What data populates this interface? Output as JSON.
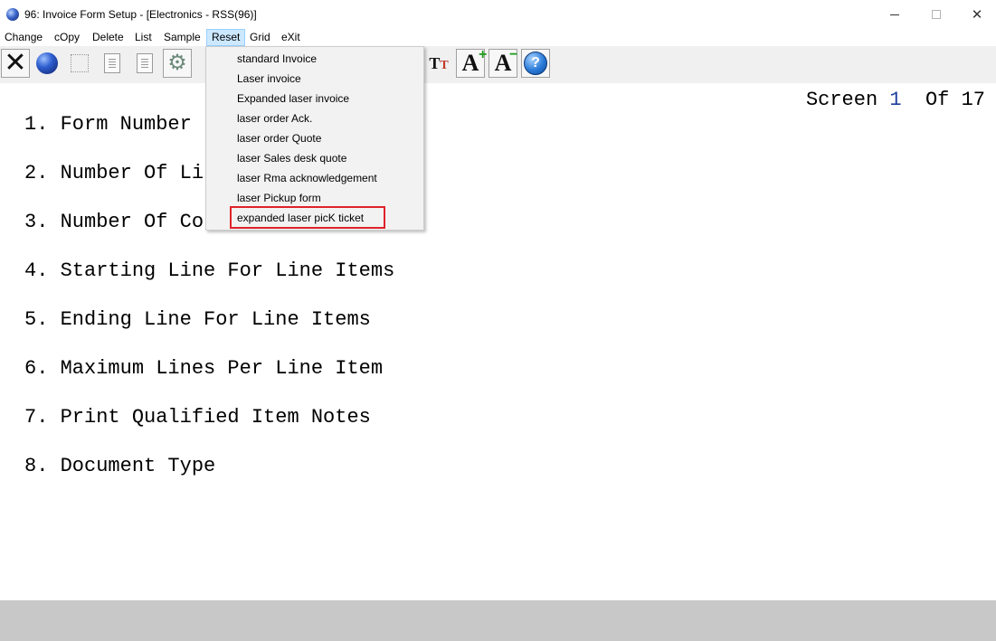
{
  "window": {
    "title": "96: Invoice Form Setup - [Electronics - RSS(96)]",
    "minimize_icon": "minimize-icon",
    "maximize_icon": "maximize-icon",
    "close_glyph": "✕"
  },
  "menubar": {
    "items": [
      "Change",
      "cOpy",
      "Delete",
      "List",
      "Sample",
      "Reset",
      "Grid",
      "eXit"
    ],
    "active": "Reset"
  },
  "toolbar": {
    "icons": [
      "close-x-icon",
      "globe-icon",
      "select-icon",
      "copy-doc-icon",
      "paste-icon",
      "gear-icon",
      "font-tt-icon",
      "font-increase-icon",
      "font-decrease-icon",
      "help-icon"
    ],
    "help_glyph": "?"
  },
  "reset_menu": {
    "items": [
      "standard Invoice",
      "Laser invoice",
      "Expanded laser invoice",
      "laser order Ack.",
      "laser order Quote",
      "laser Sales desk quote",
      "laser Rma acknowledgement",
      "laser Pickup form",
      "expanded laser picK ticket"
    ],
    "highlighted": "expanded laser picK ticket"
  },
  "screen": {
    "label": "Screen",
    "current": "1",
    "of_label": "Of",
    "total": "17"
  },
  "fields": [
    "1. Form Number",
    "2. Number Of Li",
    "3. Number Of Co",
    "4. Starting Line For Line Items",
    "5. Ending Line For Line Items",
    "6. Maximum Lines Per Line Item",
    "7. Print Qualified Item Notes",
    "8. Document Type"
  ],
  "colors": {
    "highlight_border": "#e0222a",
    "active_menu_bg": "#cce8ff",
    "screen_number": "#1f3f9f",
    "statusbar": "#c8c8c8"
  }
}
